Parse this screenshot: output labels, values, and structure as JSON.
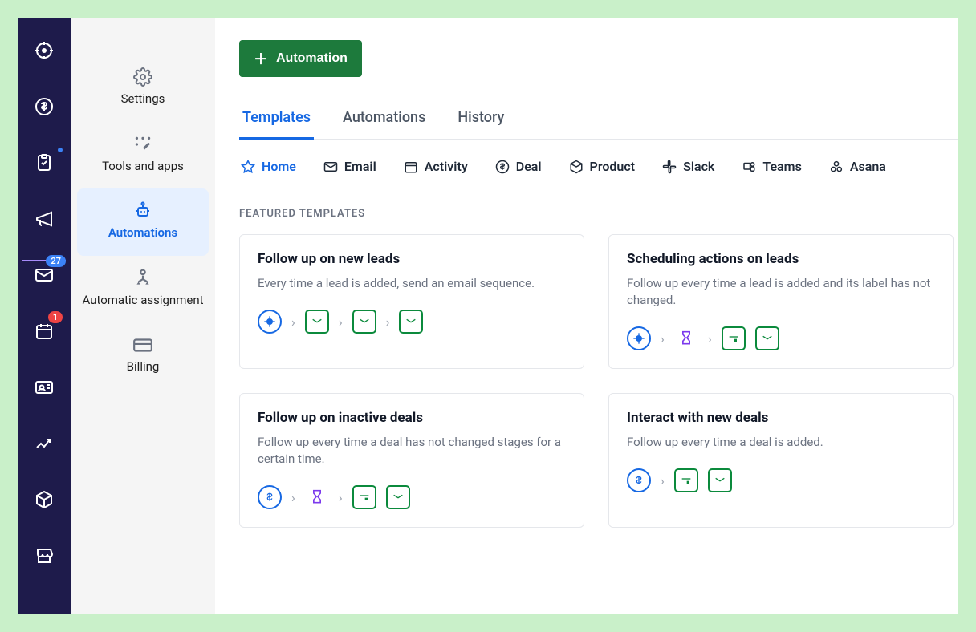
{
  "rail": {
    "items": [
      {
        "name": "leads-icon"
      },
      {
        "name": "deals-icon"
      },
      {
        "name": "projects-icon",
        "dot": true
      },
      {
        "name": "campaigns-icon"
      },
      {
        "name": "mail-icon",
        "badge": "27",
        "badge_color": "blue"
      },
      {
        "name": "activities-icon",
        "badge": "1",
        "badge_color": "red"
      },
      {
        "name": "contacts-icon"
      },
      {
        "name": "insights-icon"
      },
      {
        "name": "products-icon"
      },
      {
        "name": "marketplace-icon"
      }
    ]
  },
  "sub_sidebar": {
    "items": [
      {
        "label": "Settings"
      },
      {
        "label": "Tools and apps"
      },
      {
        "label": "Automations",
        "active": true
      },
      {
        "label": "Automatic assignment"
      },
      {
        "label": "Billing"
      }
    ]
  },
  "main": {
    "primary_button": "Automation",
    "tabs": [
      {
        "label": "Templates",
        "active": true
      },
      {
        "label": "Automations"
      },
      {
        "label": "History"
      }
    ],
    "filters": [
      {
        "label": "Home",
        "active": true
      },
      {
        "label": "Email"
      },
      {
        "label": "Activity"
      },
      {
        "label": "Deal"
      },
      {
        "label": "Product"
      },
      {
        "label": "Slack"
      },
      {
        "label": "Teams"
      },
      {
        "label": "Asana"
      }
    ],
    "section_label": "FEATURED TEMPLATES",
    "cards": [
      {
        "title": "Follow up on new leads",
        "desc": "Every time a lead is added, send an email sequence.",
        "flow": [
          "target-blue",
          ">",
          "mail-green",
          ">",
          "mail-green",
          ">",
          "mail-green"
        ]
      },
      {
        "title": "Scheduling actions on leads",
        "desc": "Follow up every time a lead is added and its label has not changed.",
        "flow": [
          "target-blue",
          ">",
          "hourglass-purple",
          ">",
          "calendar-green",
          "mail-green"
        ]
      },
      {
        "title": "Follow up on inactive deals",
        "desc": "Follow up every time a deal has not changed stages for a certain time.",
        "flow": [
          "dollar-blue",
          ">",
          "hourglass-purple",
          ">",
          "calendar-green",
          "mail-green"
        ]
      },
      {
        "title": "Interact with new deals",
        "desc": "Follow up every time a deal is added.",
        "flow": [
          "dollar-blue",
          ">",
          "calendar-green",
          "mail-green"
        ]
      }
    ]
  }
}
